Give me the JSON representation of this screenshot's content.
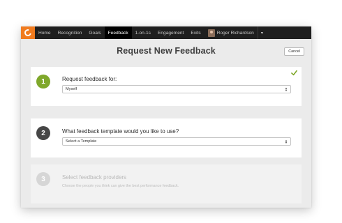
{
  "nav": {
    "items": [
      {
        "label": "Home",
        "active": false
      },
      {
        "label": "Recognition",
        "active": false
      },
      {
        "label": "Goals",
        "active": false
      },
      {
        "label": "Feedback",
        "active": true
      },
      {
        "label": "1-on-1s",
        "active": false
      },
      {
        "label": "Engagement",
        "active": false
      },
      {
        "label": "Exits",
        "active": false
      }
    ],
    "user_name": "Roger Richardson",
    "caret": "▾"
  },
  "page": {
    "title": "Request New Feedback",
    "cancel_label": "Cancel"
  },
  "steps": [
    {
      "number": "1",
      "label": "Request feedback for:",
      "select_value": "Myself",
      "completed": true
    },
    {
      "number": "2",
      "label": "What feedback template would you like to use?",
      "select_value": "Select a Template"
    },
    {
      "number": "3",
      "label": "Select feedback providers",
      "subtext": "Choose the people you think can give the best performance feedback."
    }
  ],
  "colors": {
    "brand_orange": "#f07b1f",
    "step_complete_green": "#7fa82b",
    "step_active": "#464646",
    "step_disabled": "#d6d6d6"
  },
  "icons": {
    "logo": "orange-logo-icon",
    "check": "check-icon",
    "select_arrows": "select-arrows-icon",
    "avatar": "user-avatar"
  }
}
